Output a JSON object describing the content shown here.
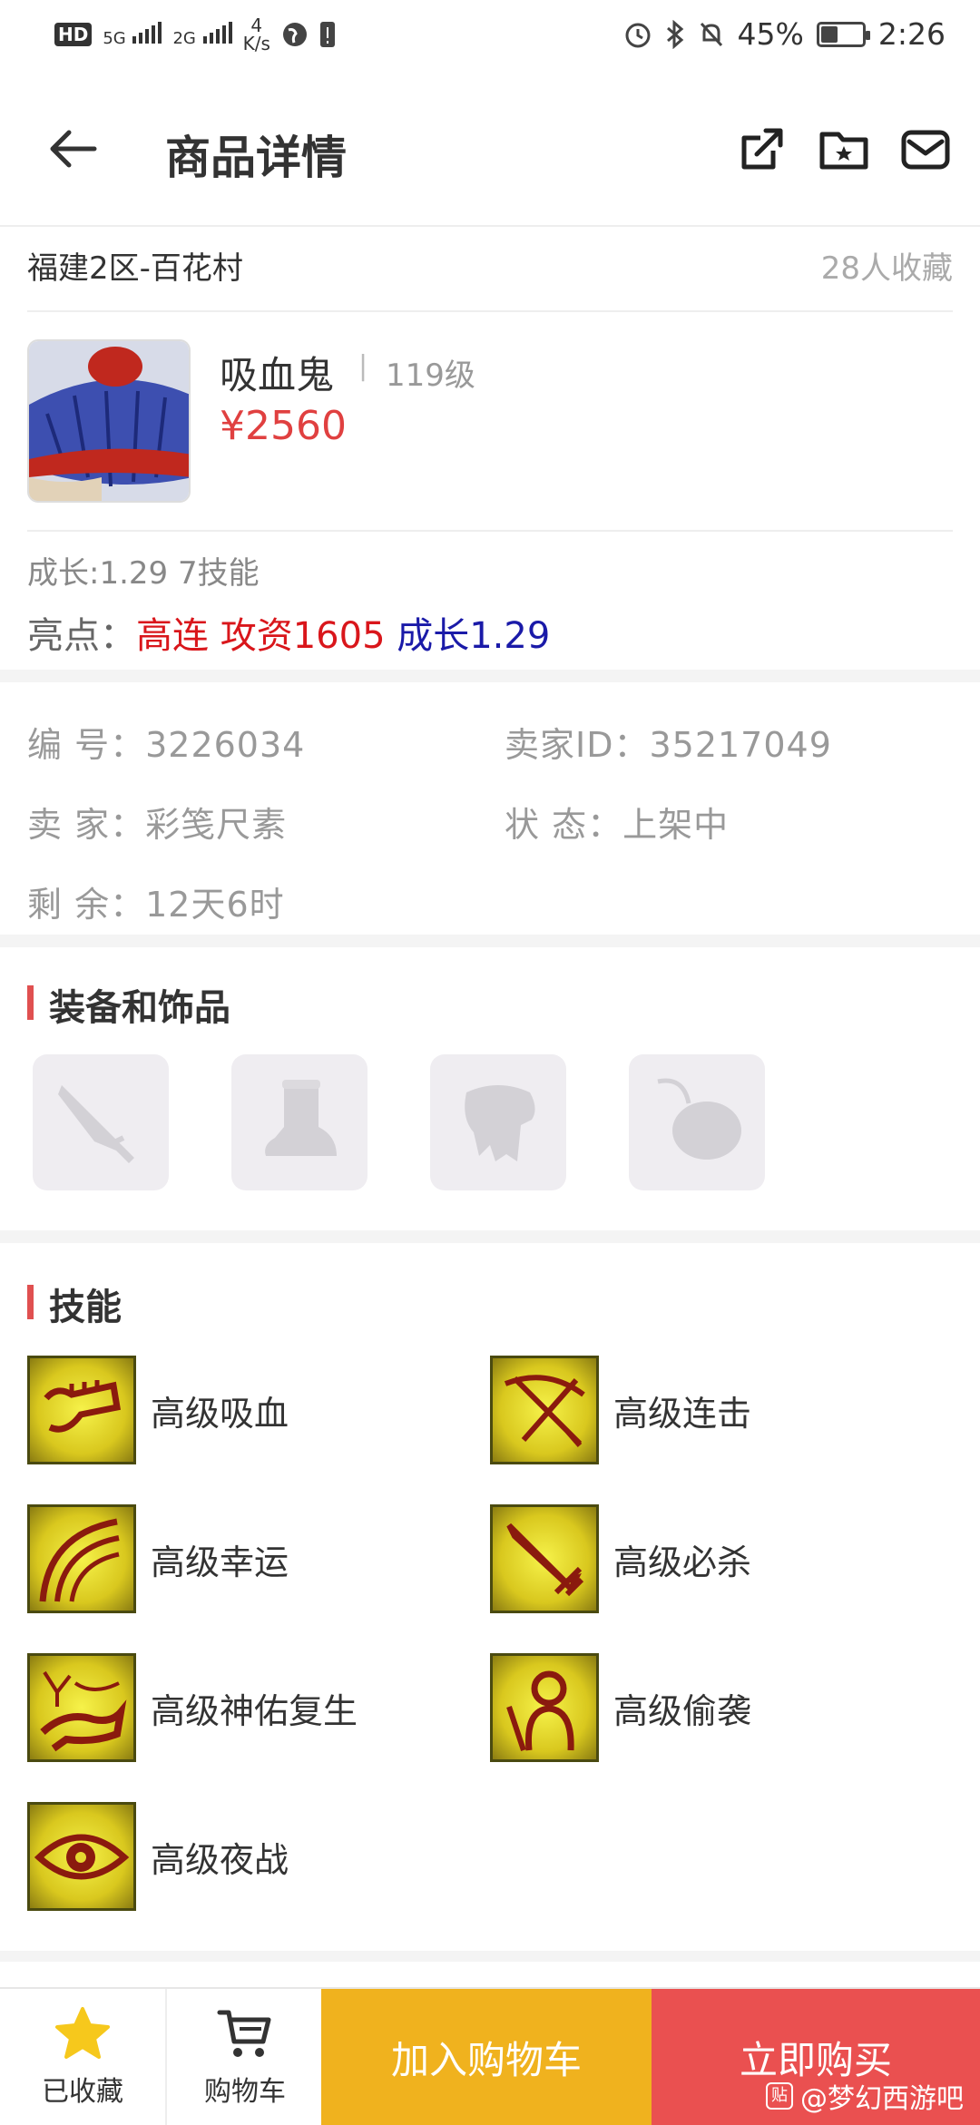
{
  "status_bar": {
    "hd": "HD",
    "signal1": "5G",
    "signal2": "2G",
    "net_speed_value": "4",
    "net_speed_unit": "K/s",
    "battery": "45%",
    "time": "2:26"
  },
  "nav": {
    "title": "商品详情"
  },
  "region": {
    "server": "福建2区-百花村",
    "fav_count": "28人收藏"
  },
  "item": {
    "name": "吸血鬼",
    "separator": "|",
    "level": "119级",
    "price": "¥2560",
    "growth_skills": "成长:1.29 7技能",
    "highlight_label": "亮点：",
    "highlight_1": "高连",
    "highlight_2": "攻资1605",
    "highlight_3": "成长1.29"
  },
  "info": {
    "id_label": "编  号：",
    "id_value": "3226034",
    "seller_id_label": "卖家ID：",
    "seller_id_value": "35217049",
    "seller_label": "卖  家：",
    "seller_value": "彩笺尺素",
    "status_label": "状  态：",
    "status_value": "上架中",
    "remain_label": "剩  余：",
    "remain_value": "12天6时"
  },
  "equipment": {
    "title": "装备和饰品",
    "slots": [
      "weapon-icon",
      "boot-icon",
      "armor-icon",
      "accessory-icon"
    ]
  },
  "skills": {
    "title": "技能",
    "items": [
      "高级吸血",
      "高级连击",
      "高级幸运",
      "高级必杀",
      "高级神佑复生",
      "高级偷袭",
      "高级夜战"
    ]
  },
  "bottom": {
    "favorited": "已收藏",
    "cart": "购物车",
    "add_cart": "加入购物车",
    "buy_now": "立即购买",
    "watermark": "@梦幻西游吧",
    "watermark_badge": "贴"
  },
  "colors": {
    "price_red": "#e04040",
    "highlight_red": "#d9161b",
    "highlight_blue": "#1a1aa8",
    "add_cart_bg": "#f0b21e",
    "buy_now_bg": "#ea5050",
    "star": "#f6c81c"
  }
}
